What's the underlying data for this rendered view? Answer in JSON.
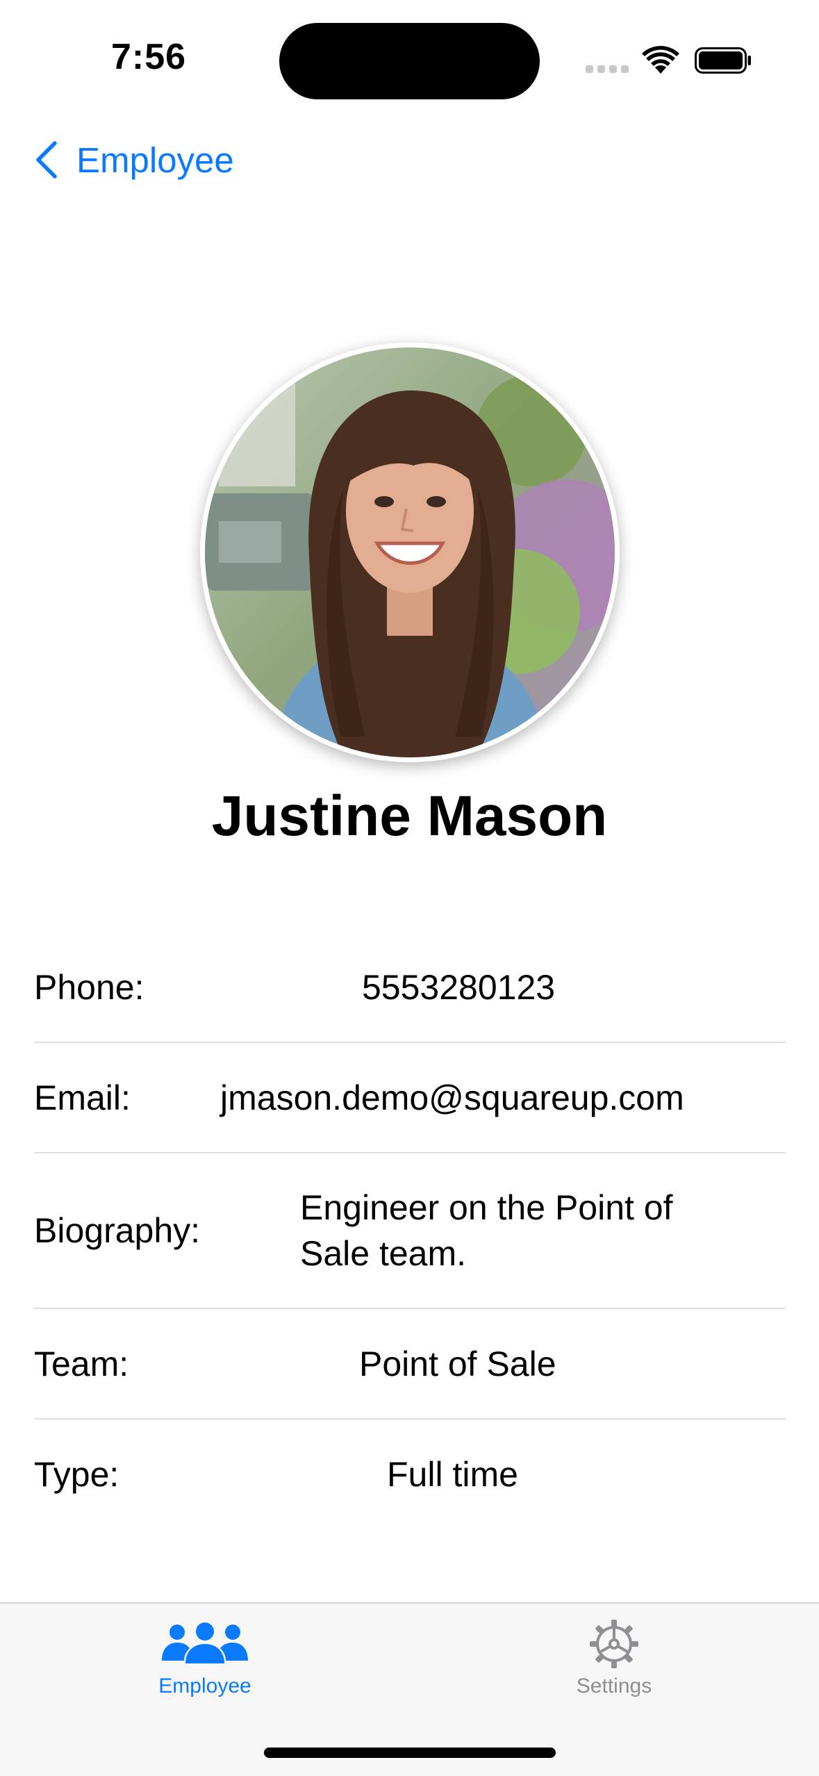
{
  "status_bar": {
    "time": "7:56"
  },
  "nav": {
    "back_label": "Employee"
  },
  "profile": {
    "name": "Justine Mason",
    "photo_icon": "employee-photo"
  },
  "details": {
    "phone": {
      "label": "Phone:",
      "value": "5553280123"
    },
    "email": {
      "label": "Email:",
      "value": "jmason.demo@squareup.com"
    },
    "bio": {
      "label": "Biography:",
      "value_line1": "Engineer on the Point of",
      "value_line2": "Sale team."
    },
    "team": {
      "label": "Team:",
      "value": "Point of Sale"
    },
    "type": {
      "label": "Type:",
      "value": "Full time"
    }
  },
  "tabs": [
    {
      "label": "Employee",
      "icon": "people-icon",
      "selected": true
    },
    {
      "label": "Settings",
      "icon": "gear-icon",
      "selected": false
    }
  ],
  "colors": {
    "accent": "#0a7aff",
    "inactive_tab": "#8e8e93",
    "separator": "#dedee3",
    "tabbar_bg": "#f7f7f7"
  }
}
